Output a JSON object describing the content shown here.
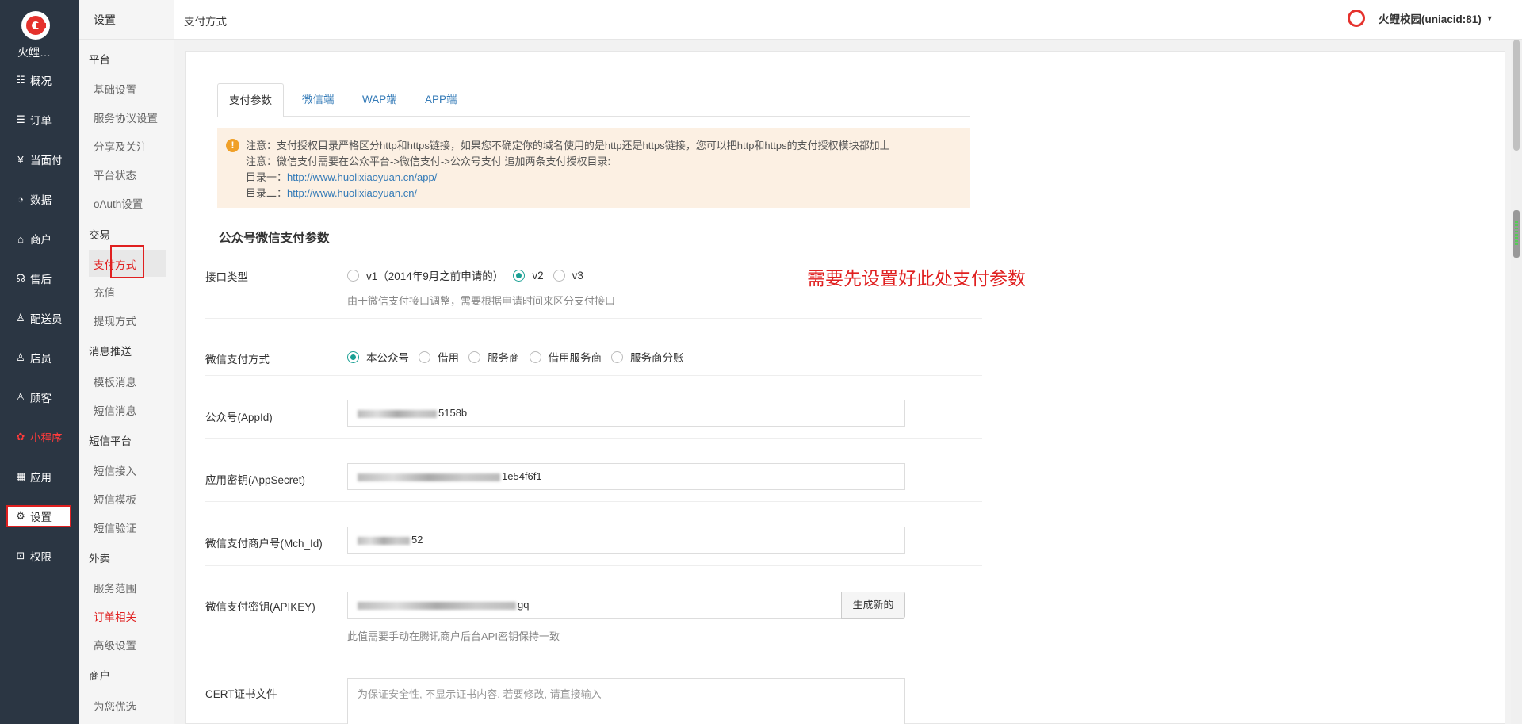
{
  "nav": {
    "brand": "火鲤…",
    "items": [
      {
        "label": "概况",
        "icon": "overview-icon",
        "glyph": "☷"
      },
      {
        "label": "订单",
        "icon": "order-icon",
        "glyph": "☰"
      },
      {
        "label": "当面付",
        "icon": "pay-icon",
        "glyph": "¥"
      },
      {
        "label": "数据",
        "icon": "chart-icon",
        "glyph": "◔"
      },
      {
        "label": "商户",
        "icon": "shop-icon",
        "glyph": "⌂"
      },
      {
        "label": "售后",
        "icon": "service-icon",
        "glyph": "☊"
      },
      {
        "label": "配送员",
        "icon": "courier-icon",
        "glyph": "♙"
      },
      {
        "label": "店员",
        "icon": "staff-icon",
        "glyph": "♙"
      },
      {
        "label": "顾客",
        "icon": "customer-icon",
        "glyph": "♙"
      },
      {
        "label": "小程序",
        "icon": "miniapp-icon",
        "glyph": "✿"
      },
      {
        "label": "应用",
        "icon": "apps-icon",
        "glyph": "▦"
      },
      {
        "label": "设置",
        "icon": "gear-icon",
        "glyph": "⚙"
      },
      {
        "label": "权限",
        "icon": "lock-icon",
        "glyph": "⊡"
      }
    ]
  },
  "subnav": {
    "title": "设置",
    "groups": [
      {
        "label": "平台"
      },
      {
        "label": "交易"
      },
      {
        "label": "消息推送"
      },
      {
        "label": "短信平台"
      },
      {
        "label": "外卖"
      },
      {
        "label": "商户"
      }
    ],
    "items": [
      {
        "label": "基础设置"
      },
      {
        "label": "服务协议设置"
      },
      {
        "label": "分享及关注"
      },
      {
        "label": "平台状态"
      },
      {
        "label": "oAuth设置"
      },
      {
        "label": "支付方式"
      },
      {
        "label": "充值"
      },
      {
        "label": "提现方式"
      },
      {
        "label": "模板消息"
      },
      {
        "label": "短信消息"
      },
      {
        "label": "短信接入"
      },
      {
        "label": "短信模板"
      },
      {
        "label": "短信验证"
      },
      {
        "label": "服务范围"
      },
      {
        "label": "订单相关"
      },
      {
        "label": "高级设置"
      },
      {
        "label": "为您优选"
      }
    ]
  },
  "header": {
    "title": "支付方式",
    "user": "火鲤校园(uniacid:81)"
  },
  "tabs": [
    "支付参数",
    "微信端",
    "WAP端",
    "APP端"
  ],
  "notice": {
    "line1": "注意：支付授权目录严格区分http和https链接，如果您不确定你的域名使用的是http还是https链接，您可以把http和https的支付授权模块都加上",
    "line2": "注意：微信支付需要在公众平台->微信支付->公众号支付 追加两条支付授权目录:",
    "dir1_label": "目录一：",
    "dir1_url": "http://www.huolixiaoyuan.cn/app/",
    "dir2_label": "目录二：",
    "dir2_url": "http://www.huolixiaoyuan.cn/"
  },
  "section_title": "公众号微信支付参数",
  "annotation": "需要先设置好此处支付参数",
  "form": {
    "api_type": {
      "label": "接口类型",
      "options": [
        "v1（2014年9月之前申请的）",
        "v2",
        "v3"
      ],
      "selected": "v2",
      "hint": "由于微信支付接口调整，需要根据申请时间来区分支付接口"
    },
    "pay_mode": {
      "label": "微信支付方式",
      "options": [
        "本公众号",
        "借用",
        "服务商",
        "借用服务商",
        "服务商分账"
      ],
      "selected": "本公众号"
    },
    "appid": {
      "label": "公众号(AppId)",
      "visible_suffix": "5158b"
    },
    "appsecret": {
      "label": "应用密钥(AppSecret)",
      "visible_suffix": "1e54f6f1"
    },
    "mch_id": {
      "label": "微信支付商户号(Mch_Id)",
      "visible_suffix": "52"
    },
    "apikey": {
      "label": "微信支付密钥(APIKEY)",
      "visible_suffix": "gq",
      "button": "生成新的",
      "hint": "此值需要手动在腾讯商户后台API密钥保持一致"
    },
    "cert": {
      "label": "CERT证书文件",
      "placeholder": "为保证安全性, 不显示证书内容. 若要修改, 请直接输入"
    }
  },
  "colors": {
    "nav_bg": "#2b3643",
    "accent": "#1aa094",
    "link": "#337ab7",
    "alert": "#e02020",
    "notice_bg": "#fcf0e3"
  }
}
